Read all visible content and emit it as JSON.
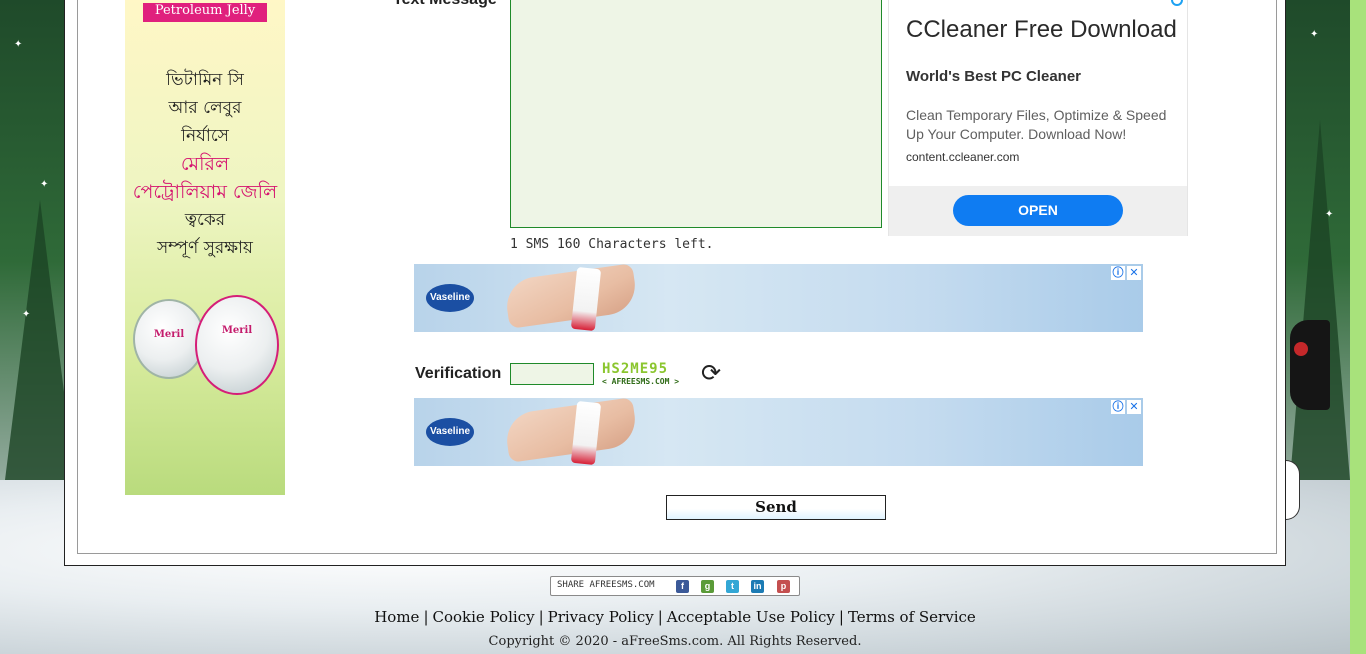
{
  "form": {
    "text_message_label": "Text Message",
    "counter": "1 SMS 160 Characters left.",
    "verification_label": "Verification",
    "captcha_code": "HS2ME95",
    "captcha_site": "< AFREESMS.COM >",
    "send_label": "Send"
  },
  "side_ad": {
    "tag": "Petroleum Jelly",
    "lines": [
      "ভিটামিন সি",
      "আর লেবুর",
      "নির্যাসে"
    ],
    "brand_lines": [
      "মেরিল",
      "পেট্রোলিয়াম জেলি"
    ],
    "tail_lines": [
      "ত্বকের",
      "সম্পূর্ণ সুরক্ষায়"
    ],
    "jar_label": "Meril"
  },
  "cc_ad": {
    "title": "CCleaner Free Download",
    "subtitle": "World's Best PC Cleaner",
    "description": "Clean Temporary Files, Optimize & Speed Up Your Computer. Download Now!",
    "url": "content.ccleaner.com",
    "open_label": "OPEN"
  },
  "banner": {
    "brand": "Vaseline",
    "info_icon": "ⓘ",
    "close_icon": "✕"
  },
  "share": {
    "label": "SHARE AFREESMS.COM",
    "icons": [
      "f",
      "g",
      "t",
      "in",
      "p"
    ]
  },
  "footer": {
    "links": [
      "Home",
      "Cookie Policy",
      "Privacy Policy",
      "Acceptable Use Policy",
      "Terms of Service"
    ],
    "copyright": "Copyright © 2020 - aFreeSms.com. All Rights Reserved."
  },
  "colors": {
    "accent_green": "#1f8a2a",
    "open_button": "#0f7cf2",
    "ad_pink": "#d5136f"
  }
}
